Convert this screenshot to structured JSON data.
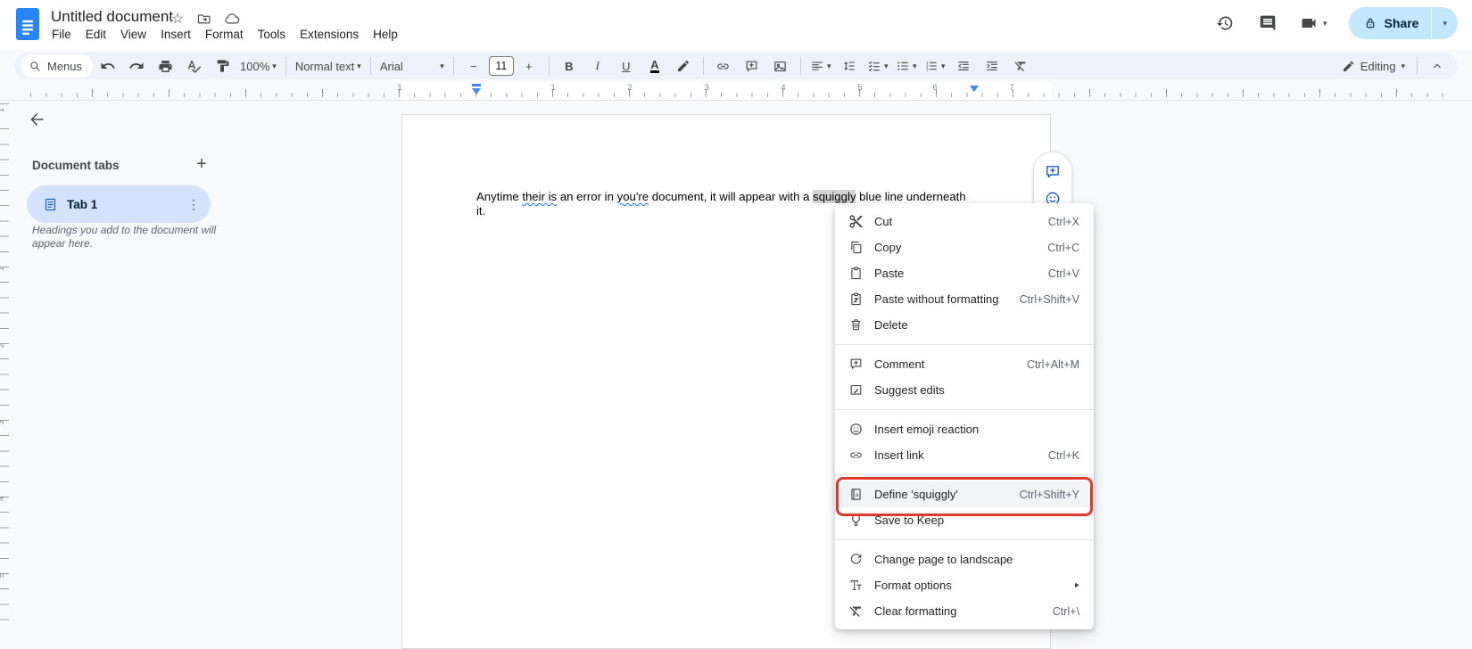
{
  "header": {
    "doc_title": "Untitled document",
    "menus": [
      "File",
      "Edit",
      "View",
      "Insert",
      "Format",
      "Tools",
      "Extensions",
      "Help"
    ],
    "share": {
      "label": "Share"
    }
  },
  "toolbar": {
    "search_label": "Menus",
    "zoom_value": "100%",
    "paragraph_style": "Normal text",
    "font_family": "Arial",
    "font_size": "11",
    "bold": "B",
    "italic": "I",
    "underline": "U",
    "text_color": "A",
    "mode": {
      "label": "Editing"
    }
  },
  "ruler": {
    "h_numbers": [
      "1",
      "1",
      "2",
      "3",
      "4",
      "5",
      "6",
      "7"
    ],
    "v_numbers": [
      "1",
      "1",
      "2",
      "3",
      "4",
      "5"
    ]
  },
  "sidebar": {
    "heading": "Document tabs",
    "add_label": "+",
    "tab": {
      "label": "Tab 1",
      "menu_glyph": "⋮"
    },
    "hint": "Headings you add to the document will appear here."
  },
  "document": {
    "parts": [
      {
        "text": "Anytime "
      },
      {
        "text": "their is",
        "error": true
      },
      {
        "text": " an error in "
      },
      {
        "text": "you're",
        "error": true
      },
      {
        "text": " document, it will appear with a "
      },
      {
        "text": "squiggly",
        "selected": true
      },
      {
        "text": " blue line underneath"
      },
      {
        "text": "it."
      }
    ]
  },
  "context_menu": {
    "groups": [
      {
        "items": [
          {
            "icon": "scissors",
            "label": "Cut",
            "shortcut": "Ctrl+X"
          },
          {
            "icon": "copy",
            "label": "Copy",
            "shortcut": "Ctrl+C"
          },
          {
            "icon": "clipboard-paste",
            "label": "Paste",
            "shortcut": "Ctrl+V"
          },
          {
            "icon": "clipboard-paste-plain",
            "label": "Paste without formatting",
            "shortcut": "Ctrl+Shift+V"
          },
          {
            "icon": "trash",
            "label": "Delete",
            "shortcut": ""
          }
        ]
      },
      {
        "items": [
          {
            "icon": "add-comment",
            "label": "Comment",
            "shortcut": "Ctrl+Alt+M"
          },
          {
            "icon": "suggest-edits",
            "label": "Suggest edits",
            "shortcut": ""
          }
        ]
      },
      {
        "items": [
          {
            "icon": "emoji",
            "label": "Insert emoji reaction",
            "shortcut": ""
          },
          {
            "icon": "link",
            "label": "Insert link",
            "shortcut": "Ctrl+K"
          }
        ]
      },
      {
        "items": [
          {
            "icon": "dictionary",
            "label": "Define 'squiggly'",
            "shortcut": "Ctrl+Shift+Y",
            "highlighted": true
          },
          {
            "icon": "lightbulb",
            "label": "Save to Keep",
            "shortcut": ""
          }
        ]
      },
      {
        "items": [
          {
            "icon": "rotate-page",
            "label": "Change page to landscape",
            "shortcut": ""
          },
          {
            "icon": "format-options",
            "label": "Format options",
            "shortcut": "",
            "submenu": "▸"
          },
          {
            "icon": "clear-formatting",
            "label": "Clear formatting",
            "shortcut": "Ctrl+\\"
          }
        ]
      }
    ]
  },
  "colors": {
    "toolbar_bg": "#edf2fa",
    "share_bg": "#c2e7ff",
    "tab_pill_bg": "#d3e3fd",
    "annotation_red": "#e5382c",
    "accent_blue": "#0b57d0",
    "squiggle_blue": "#1a73e8"
  }
}
